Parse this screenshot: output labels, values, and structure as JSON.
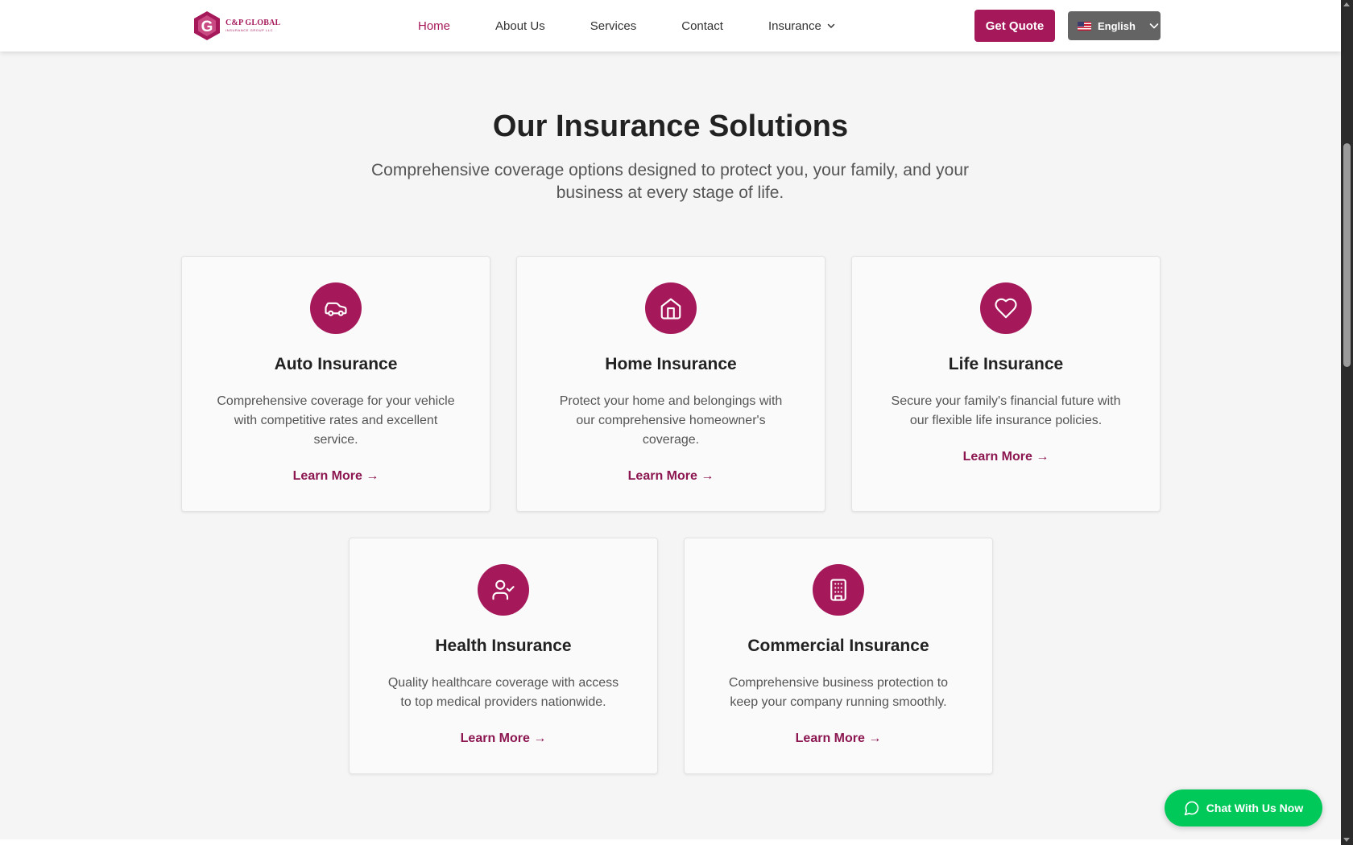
{
  "header": {
    "logo": {
      "name": "C&P GLOBAL",
      "tagline": "INSURANCE GROUP LLC",
      "letter": "G"
    },
    "nav": [
      {
        "label": "Home",
        "active": true
      },
      {
        "label": "About Us"
      },
      {
        "label": "Services"
      },
      {
        "label": "Contact"
      },
      {
        "label": "Insurance",
        "has_dropdown": true
      }
    ],
    "quote_label": "Get Quote",
    "language_label": "English"
  },
  "section": {
    "title": "Our Insurance Solutions",
    "subtitle": "Comprehensive coverage options designed to protect you, your family, and your business at every stage of life."
  },
  "cards": [
    {
      "icon": "car-icon",
      "title": "Auto Insurance",
      "desc": "Comprehensive coverage for your vehicle with competitive rates and excellent service.",
      "link": "Learn More →"
    },
    {
      "icon": "home-icon",
      "title": "Home Insurance",
      "desc": "Protect your home and belongings with our comprehensive homeowner's coverage.",
      "link": "Learn More →"
    },
    {
      "icon": "heart-icon",
      "title": "Life Insurance",
      "desc": "Secure your family's financial future with our flexible life insurance policies.",
      "link": "Learn More →"
    },
    {
      "icon": "user-check-icon",
      "title": "Health Insurance",
      "desc": "Quality healthcare coverage with access to top medical providers nationwide.",
      "link": "Learn More →"
    },
    {
      "icon": "building-icon",
      "title": "Commercial Insurance",
      "desc": "Comprehensive business protection to keep your company running smoothly.",
      "link": "Learn More →"
    }
  ],
  "chat": {
    "label": "Chat With Us Now"
  },
  "colors": {
    "brand": "#a5195b",
    "chat": "#00c95a",
    "background": "#f5f5f5"
  }
}
